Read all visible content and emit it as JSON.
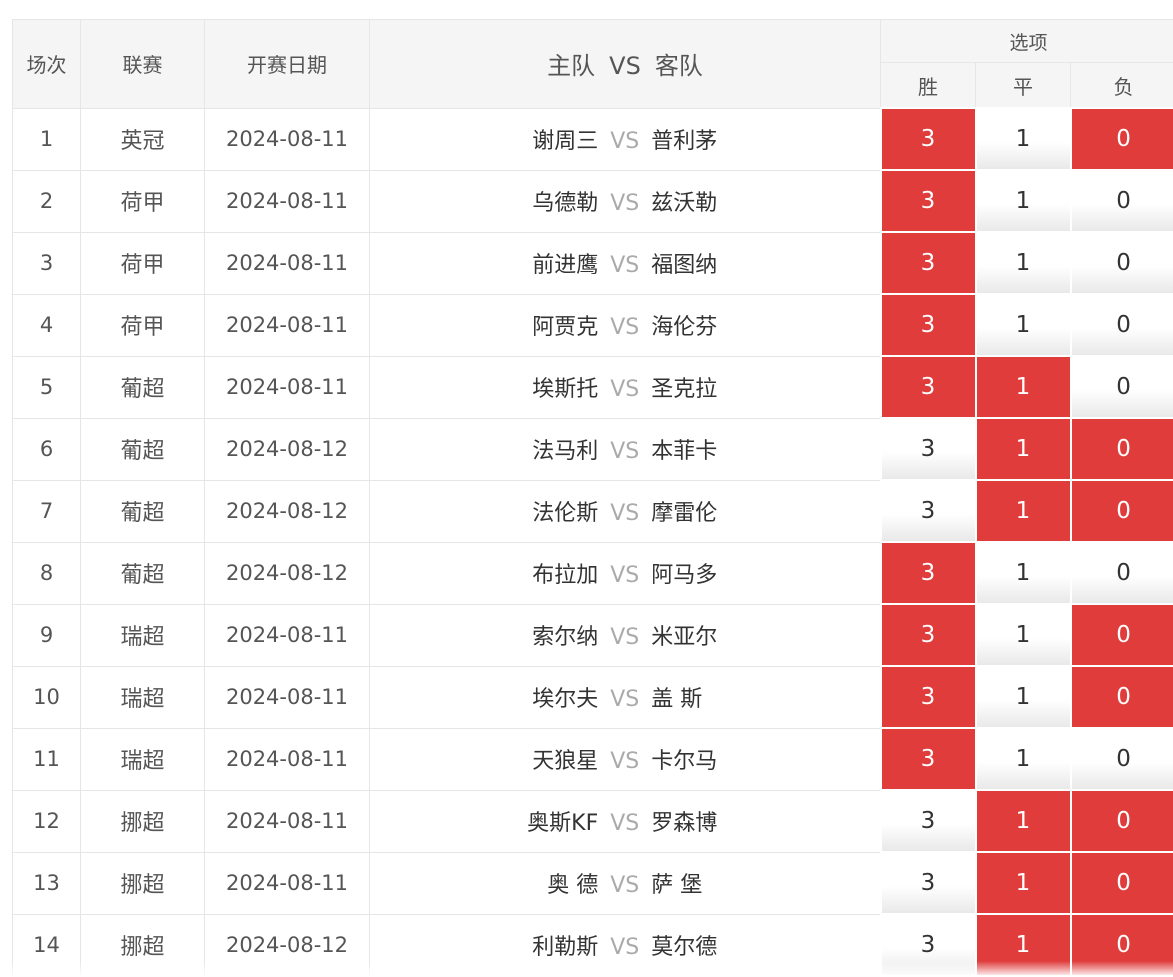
{
  "header": {
    "round": "场次",
    "league": "联赛",
    "date": "开赛日期",
    "home": "主队",
    "vs": "VS",
    "away": "客队",
    "options": "选项",
    "win": "胜",
    "draw": "平",
    "lose": "负"
  },
  "vs_text": "VS",
  "rows": [
    {
      "no": "1",
      "league": "英冠",
      "date": "2024-08-11",
      "home": "谢周三",
      "away": "普利茅",
      "opts": [
        {
          "label": "3",
          "selected": true
        },
        {
          "label": "1",
          "selected": false
        },
        {
          "label": "0",
          "selected": true
        }
      ]
    },
    {
      "no": "2",
      "league": "荷甲",
      "date": "2024-08-11",
      "home": "乌德勒",
      "away": "兹沃勒",
      "opts": [
        {
          "label": "3",
          "selected": true
        },
        {
          "label": "1",
          "selected": false
        },
        {
          "label": "0",
          "selected": false
        }
      ]
    },
    {
      "no": "3",
      "league": "荷甲",
      "date": "2024-08-11",
      "home": "前进鹰",
      "away": "福图纳",
      "opts": [
        {
          "label": "3",
          "selected": true
        },
        {
          "label": "1",
          "selected": false
        },
        {
          "label": "0",
          "selected": false
        }
      ]
    },
    {
      "no": "4",
      "league": "荷甲",
      "date": "2024-08-11",
      "home": "阿贾克",
      "away": "海伦芬",
      "opts": [
        {
          "label": "3",
          "selected": true
        },
        {
          "label": "1",
          "selected": false
        },
        {
          "label": "0",
          "selected": false
        }
      ]
    },
    {
      "no": "5",
      "league": "葡超",
      "date": "2024-08-11",
      "home": "埃斯托",
      "away": "圣克拉",
      "opts": [
        {
          "label": "3",
          "selected": true
        },
        {
          "label": "1",
          "selected": true
        },
        {
          "label": "0",
          "selected": false
        }
      ]
    },
    {
      "no": "6",
      "league": "葡超",
      "date": "2024-08-12",
      "home": "法马利",
      "away": "本菲卡",
      "opts": [
        {
          "label": "3",
          "selected": false
        },
        {
          "label": "1",
          "selected": true
        },
        {
          "label": "0",
          "selected": true
        }
      ]
    },
    {
      "no": "7",
      "league": "葡超",
      "date": "2024-08-12",
      "home": "法伦斯",
      "away": "摩雷伦",
      "opts": [
        {
          "label": "3",
          "selected": false
        },
        {
          "label": "1",
          "selected": true
        },
        {
          "label": "0",
          "selected": true
        }
      ]
    },
    {
      "no": "8",
      "league": "葡超",
      "date": "2024-08-12",
      "home": "布拉加",
      "away": "阿马多",
      "opts": [
        {
          "label": "3",
          "selected": true
        },
        {
          "label": "1",
          "selected": false
        },
        {
          "label": "0",
          "selected": false
        }
      ]
    },
    {
      "no": "9",
      "league": "瑞超",
      "date": "2024-08-11",
      "home": "索尔纳",
      "away": "米亚尔",
      "opts": [
        {
          "label": "3",
          "selected": true
        },
        {
          "label": "1",
          "selected": false
        },
        {
          "label": "0",
          "selected": true
        }
      ]
    },
    {
      "no": "10",
      "league": "瑞超",
      "date": "2024-08-11",
      "home": "埃尔夫",
      "away": "盖 斯",
      "opts": [
        {
          "label": "3",
          "selected": true
        },
        {
          "label": "1",
          "selected": false
        },
        {
          "label": "0",
          "selected": true
        }
      ]
    },
    {
      "no": "11",
      "league": "瑞超",
      "date": "2024-08-11",
      "home": "天狼星",
      "away": "卡尔马",
      "opts": [
        {
          "label": "3",
          "selected": true
        },
        {
          "label": "1",
          "selected": false
        },
        {
          "label": "0",
          "selected": false
        }
      ]
    },
    {
      "no": "12",
      "league": "挪超",
      "date": "2024-08-11",
      "home": "奥斯KF",
      "away": "罗森博",
      "opts": [
        {
          "label": "3",
          "selected": false
        },
        {
          "label": "1",
          "selected": true
        },
        {
          "label": "0",
          "selected": true
        }
      ]
    },
    {
      "no": "13",
      "league": "挪超",
      "date": "2024-08-11",
      "home": "奥 德",
      "away": "萨 堡",
      "opts": [
        {
          "label": "3",
          "selected": false
        },
        {
          "label": "1",
          "selected": true
        },
        {
          "label": "0",
          "selected": true
        }
      ]
    },
    {
      "no": "14",
      "league": "挪超",
      "date": "2024-08-12",
      "home": "利勒斯",
      "away": "莫尔德",
      "opts": [
        {
          "label": "3",
          "selected": false
        },
        {
          "label": "1",
          "selected": true
        },
        {
          "label": "0",
          "selected": true
        }
      ]
    }
  ]
}
